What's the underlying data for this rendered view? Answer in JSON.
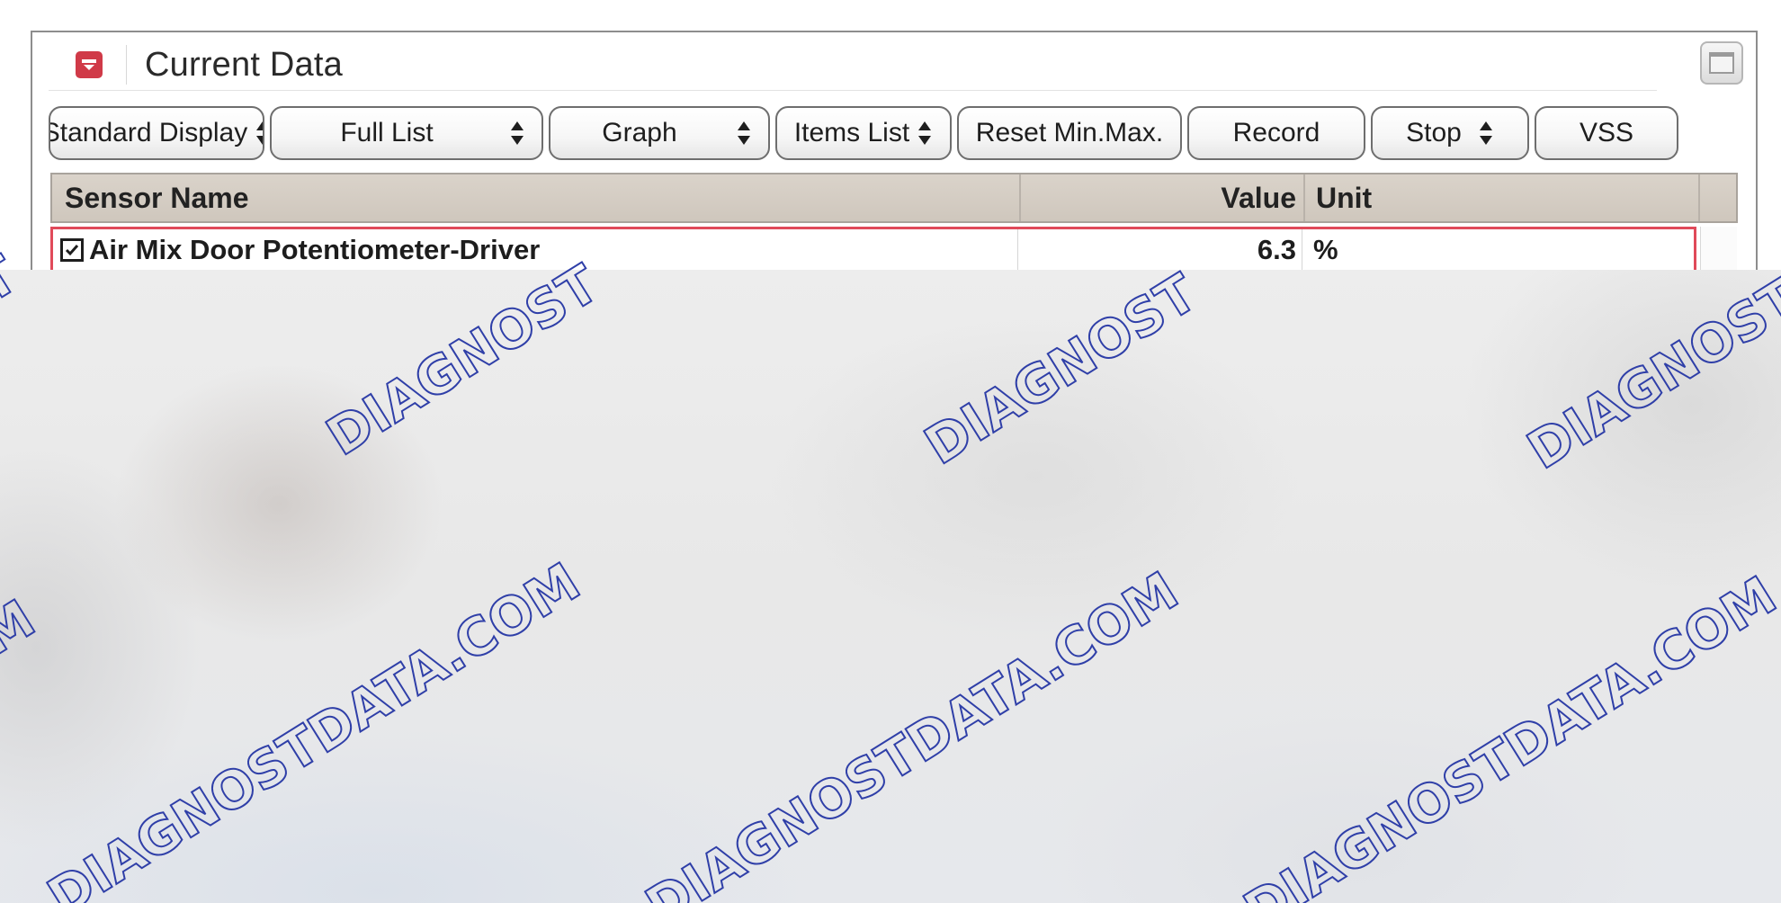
{
  "panel": {
    "title": "Current Data",
    "collapse_icon": "chevron-down-icon",
    "restore_icon": "window-restore-icon"
  },
  "toolbar": {
    "buttons": [
      {
        "label": "Standard Display",
        "spinner": true
      },
      {
        "label": "Full List",
        "spinner": true
      },
      {
        "label": "Graph",
        "spinner": true
      },
      {
        "label": "Items List",
        "spinner": true
      },
      {
        "label": "Reset Min.Max.",
        "spinner": false
      },
      {
        "label": "Record",
        "spinner": false
      },
      {
        "label": "Stop",
        "spinner": true
      },
      {
        "label": "VSS",
        "spinner": false
      }
    ]
  },
  "table": {
    "columns": [
      "Sensor Name",
      "Value",
      "Unit"
    ],
    "rows": [
      {
        "checked": true,
        "name": "Air Mix Door Potentiometer-Driver",
        "value": "6.3",
        "unit": "%"
      }
    ]
  },
  "watermark": {
    "line1": "DIAGNOST",
    "line2": "DIAGNOSTDATA.COM",
    "color": "#2f3fa8"
  },
  "colors": {
    "selection_border": "#e04a5a",
    "header_bg": "#d5cdc3",
    "collapse_icon_bg": "#d03a48"
  }
}
